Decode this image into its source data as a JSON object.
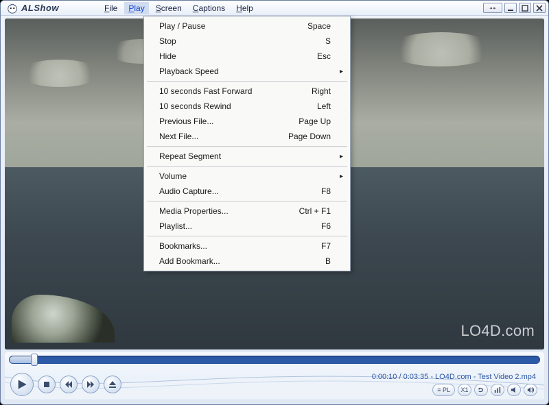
{
  "app": {
    "title": "ALShow"
  },
  "menubar": {
    "file": {
      "label": "File",
      "u": "F"
    },
    "play": {
      "label": "Play",
      "u": "P"
    },
    "screen": {
      "label": "Screen",
      "u": "S"
    },
    "captions": {
      "label": "Captions",
      "u": "C"
    },
    "help": {
      "label": "Help",
      "u": "H"
    }
  },
  "playmenu": {
    "groups": [
      [
        {
          "label": "Play / Pause",
          "accel": "Space"
        },
        {
          "label": "Stop",
          "accel": "S"
        },
        {
          "label": "Hide",
          "accel": "Esc"
        },
        {
          "label": "Playback Speed",
          "submenu": true
        }
      ],
      [
        {
          "label": "10 seconds Fast Forward",
          "accel": "Right"
        },
        {
          "label": "10 seconds Rewind",
          "accel": "Left"
        },
        {
          "label": "Previous File...",
          "accel": "Page Up"
        },
        {
          "label": "Next File...",
          "accel": "Page Down"
        }
      ],
      [
        {
          "label": "Repeat Segment",
          "submenu": true
        }
      ],
      [
        {
          "label": "Volume",
          "submenu": true
        },
        {
          "label": "Audio Capture...",
          "accel": "F8"
        }
      ],
      [
        {
          "label": "Media Properties...",
          "accel": "Ctrl + F1"
        },
        {
          "label": "Playlist...",
          "accel": "F6"
        }
      ],
      [
        {
          "label": "Bookmarks...",
          "accel": "F7"
        },
        {
          "label": "Add Bookmark...",
          "accel": "B"
        }
      ]
    ]
  },
  "status": {
    "text": "0:00:10 / 0:03:35 - LO4D.com - Test Video 2.mp4"
  },
  "watermark": {
    "text": "LO4D.com"
  },
  "extra": {
    "pl": "≡ PL",
    "x1": "X1"
  }
}
